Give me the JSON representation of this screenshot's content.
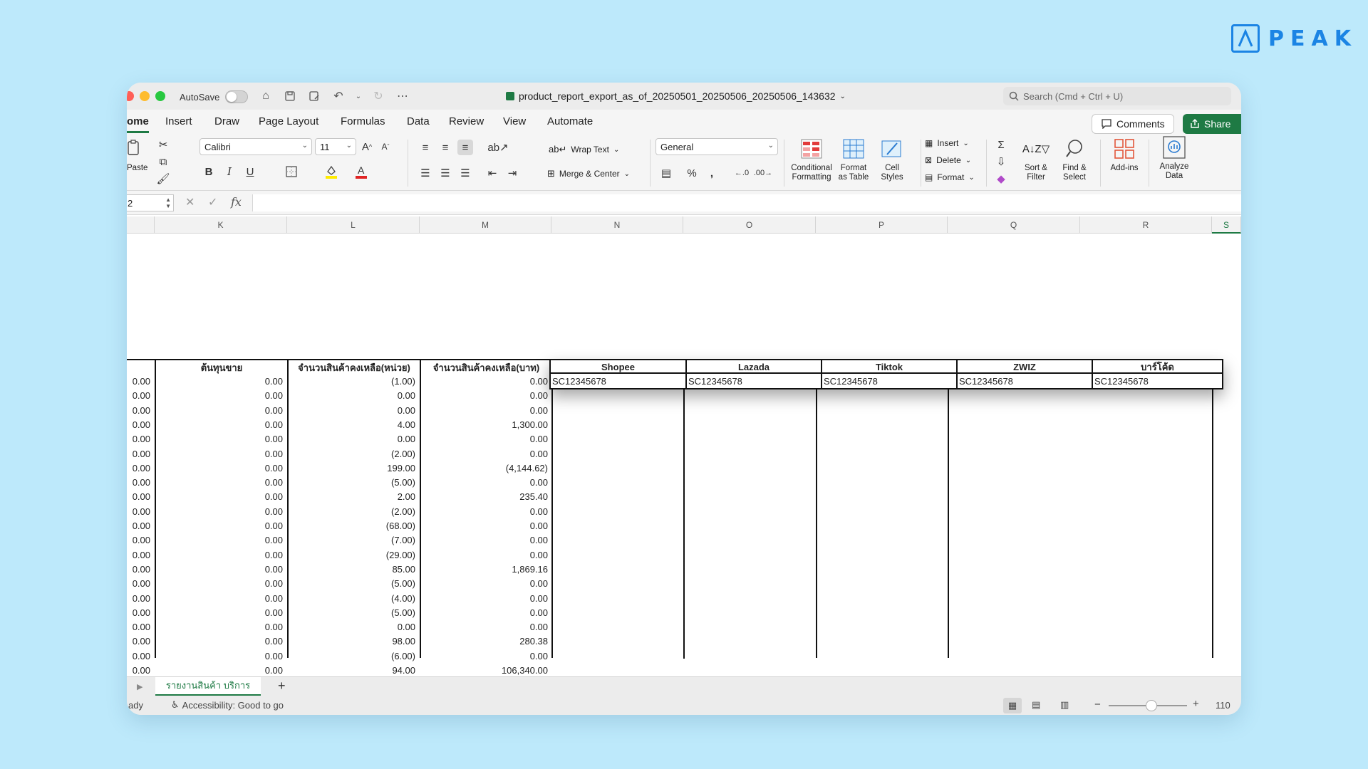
{
  "brand": {
    "name": "PEAK"
  },
  "titlebar": {
    "autosave_label": "AutoSave",
    "doc_title": "product_report_export_as_of_20250501_20250506_20250506_143632",
    "search_placeholder": "Search (Cmd + Ctrl + U)"
  },
  "tabs": [
    "ome",
    "Insert",
    "Draw",
    "Page Layout",
    "Formulas",
    "Data",
    "Review",
    "View",
    "Automate"
  ],
  "actions": {
    "comments": "Comments",
    "share": "Share"
  },
  "ribbon": {
    "paste": "Paste",
    "font_name": "Calibri",
    "font_size": "11",
    "wrap_text": "Wrap Text",
    "merge_center": "Merge & Center",
    "number_format": "General",
    "conditional": [
      "Conditional",
      "Formatting"
    ],
    "format_table": [
      "Format",
      "as Table"
    ],
    "cell_styles": [
      "Cell",
      "Styles"
    ],
    "insert": "Insert",
    "delete": "Delete",
    "format": "Format",
    "sort_filter": [
      "Sort &",
      "Filter"
    ],
    "find_select": [
      "Find &",
      "Select"
    ],
    "addins": "Add-ins",
    "analyze": [
      "Analyze",
      "Data"
    ]
  },
  "formula_bar": {
    "name_box": "2",
    "fx": "fx"
  },
  "columns": [
    "K",
    "L",
    "M",
    "N",
    "O",
    "P",
    "Q",
    "R",
    "S"
  ],
  "headers": {
    "k": "ต้นทุนขาย",
    "l": "จำนวนสินค้าคงเหลือ(หน่วย)",
    "m": "จำนวนสินค้าคงเหลือ(บาท)",
    "n": "Shopee",
    "o": "Lazada",
    "p": "Tiktok",
    "q": "ZWIZ",
    "r": "บาร์โค้ด"
  },
  "floating_values": [
    "SC12345678",
    "SC12345678",
    "SC12345678",
    "SC12345678",
    "SC12345678"
  ],
  "rows": [
    {
      "j": "0.00",
      "k": "0.00",
      "l": "(1.00)",
      "m": "0.00"
    },
    {
      "j": "0.00",
      "k": "0.00",
      "l": "0.00",
      "m": "0.00"
    },
    {
      "j": "0.00",
      "k": "0.00",
      "l": "0.00",
      "m": "0.00"
    },
    {
      "j": "0.00",
      "k": "0.00",
      "l": "4.00",
      "m": "1,300.00"
    },
    {
      "j": "0.00",
      "k": "0.00",
      "l": "0.00",
      "m": "0.00"
    },
    {
      "j": "0.00",
      "k": "0.00",
      "l": "(2.00)",
      "m": "0.00"
    },
    {
      "j": "0.00",
      "k": "0.00",
      "l": "199.00",
      "m": "(4,144.62)"
    },
    {
      "j": "0.00",
      "k": "0.00",
      "l": "(5.00)",
      "m": "0.00"
    },
    {
      "j": "0.00",
      "k": "0.00",
      "l": "2.00",
      "m": "235.40"
    },
    {
      "j": "0.00",
      "k": "0.00",
      "l": "(2.00)",
      "m": "0.00"
    },
    {
      "j": "0.00",
      "k": "0.00",
      "l": "(68.00)",
      "m": "0.00"
    },
    {
      "j": "0.00",
      "k": "0.00",
      "l": "(7.00)",
      "m": "0.00"
    },
    {
      "j": "0.00",
      "k": "0.00",
      "l": "(29.00)",
      "m": "0.00"
    },
    {
      "j": "0.00",
      "k": "0.00",
      "l": "85.00",
      "m": "1,869.16"
    },
    {
      "j": "0.00",
      "k": "0.00",
      "l": "(5.00)",
      "m": "0.00"
    },
    {
      "j": "0.00",
      "k": "0.00",
      "l": "(4.00)",
      "m": "0.00"
    },
    {
      "j": "0.00",
      "k": "0.00",
      "l": "(5.00)",
      "m": "0.00"
    },
    {
      "j": "0.00",
      "k": "0.00",
      "l": "0.00",
      "m": "0.00"
    },
    {
      "j": "0.00",
      "k": "0.00",
      "l": "98.00",
      "m": "280.38"
    },
    {
      "j": "0.00",
      "k": "0.00",
      "l": "(6.00)",
      "m": "0.00"
    },
    {
      "j": "0.00",
      "k": "0.00",
      "l": "94.00",
      "m": "106,340.00"
    }
  ],
  "sheet_tab": "รายงานสินค้า บริการ",
  "status": {
    "ready": "ady",
    "accessibility": "Accessibility: Good to go",
    "zoom": "110"
  },
  "colors": {
    "accent": "#1e7a44",
    "brand": "#1b84e4",
    "background": "#bde9fb"
  }
}
